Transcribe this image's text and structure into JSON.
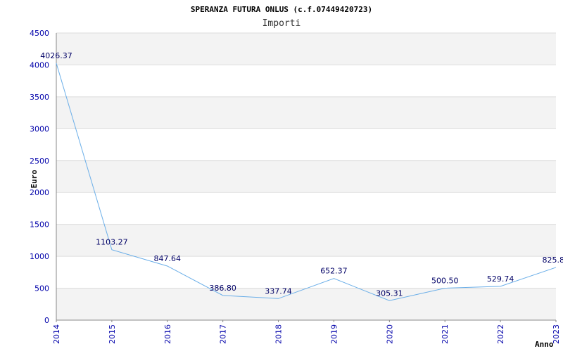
{
  "chart_data": {
    "type": "line",
    "title": "SPERANZA FUTURA ONLUS (c.f.07449420723)",
    "subtitle": "Importi",
    "ylabel": "Euro",
    "xlabel": "Anno",
    "categories": [
      "2014",
      "2015",
      "2016",
      "2017",
      "2018",
      "2019",
      "2020",
      "2021",
      "2022",
      "2023"
    ],
    "values": [
      4026.37,
      1103.27,
      847.64,
      386.8,
      337.74,
      652.37,
      305.31,
      500.5,
      529.74,
      825.8
    ],
    "value_labels": [
      "4026.37",
      "1103.27",
      "847.64",
      "386.80",
      "337.74",
      "652.37",
      "305.31",
      "500.50",
      "529.74",
      "825.8"
    ],
    "ylim": [
      0,
      4500
    ],
    "yticks": [
      "0",
      "500",
      "1000",
      "1500",
      "2000",
      "2500",
      "3000",
      "3500",
      "4000",
      "4500"
    ],
    "grid": true,
    "colors": {
      "line": "#6aaee8",
      "band": "#f3f3f3",
      "gridline": "#dddddd",
      "axis_text": "#0000aa",
      "label_text": "#000066",
      "title_text": "#000000"
    }
  }
}
